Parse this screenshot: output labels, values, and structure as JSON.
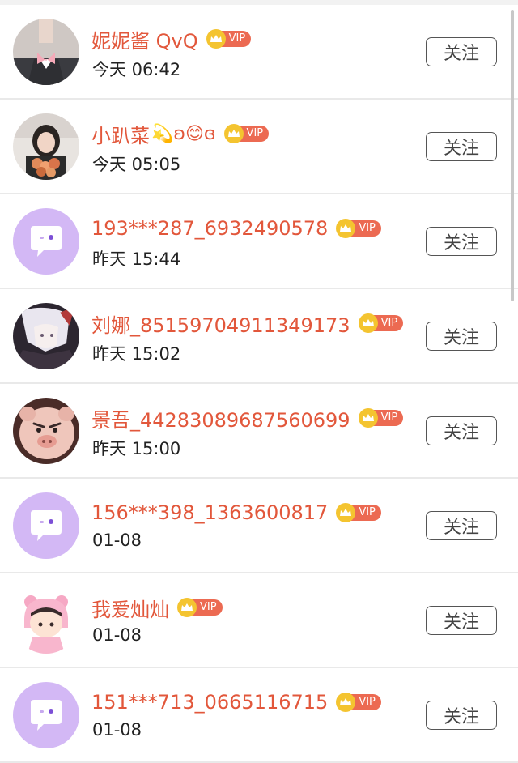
{
  "follow_label": "关注",
  "vip_label": "VIP",
  "users": [
    {
      "name": "妮妮酱 QvQ",
      "emojis": "",
      "time": "今天 06:42",
      "avatar": "photo-girl-uniform"
    },
    {
      "name": "小趴菜",
      "emojis": "💫ʚ😊ɞ",
      "time": "今天 05:05",
      "avatar": "photo-girl-flowers"
    },
    {
      "name": "193***287_6932490578",
      "emojis": "",
      "time": "昨天 15:44",
      "avatar": "default-chat-bubble"
    },
    {
      "name": "刘娜_85159704911349173",
      "emojis": "",
      "time": "昨天 15:02",
      "avatar": "anime-white-hair"
    },
    {
      "name": "景吾_44283089687560699",
      "emojis": "",
      "time": "昨天 15:00",
      "avatar": "pig-face"
    },
    {
      "name": "156***398_1363600817",
      "emojis": "",
      "time": "01-08",
      "avatar": "default-chat-bubble"
    },
    {
      "name": "我爱灿灿",
      "emojis": "",
      "time": "01-08",
      "avatar": "cartoon-pink-bear"
    },
    {
      "name": "151***713_0665116715",
      "emojis": "",
      "time": "01-08",
      "avatar": "default-chat-bubble"
    }
  ],
  "colors": {
    "name": "#e2573b",
    "vip_tag": "#ec6a52",
    "vip_crown": "#f4c430",
    "default_avatar_bg": "#d3b8f5"
  }
}
